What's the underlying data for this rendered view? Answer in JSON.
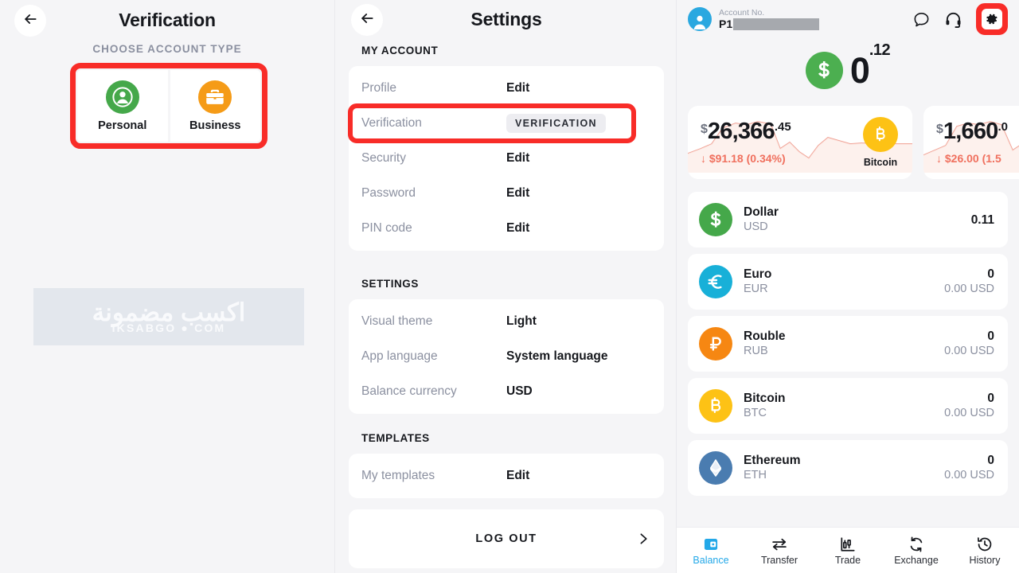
{
  "verification_panel": {
    "back_icon": "arrow-left-icon",
    "title": "Verification",
    "subtitle": "CHOOSE ACCOUNT TYPE",
    "account_types": [
      {
        "label": "Personal",
        "icon": "person-circle-icon",
        "color": "#45a84a"
      },
      {
        "label": "Business",
        "icon": "briefcase-icon",
        "color": "#f59b17"
      }
    ],
    "highlight_color": "#f82c28",
    "watermark": {
      "arabic": "اكسب مضمونة",
      "latin": "IKSABGO ● COM"
    }
  },
  "settings_panel": {
    "back_icon": "arrow-left-icon",
    "title": "Settings",
    "sections": [
      {
        "heading": "MY ACCOUNT",
        "rows": [
          {
            "label": "Profile",
            "value": "Edit",
            "type": "value"
          },
          {
            "label": "Verification",
            "value": "VERIFICATION",
            "type": "badge",
            "highlighted": true
          },
          {
            "label": "Security",
            "value": "Edit",
            "type": "value"
          },
          {
            "label": "Password",
            "value": "Edit",
            "type": "value"
          },
          {
            "label": "PIN code",
            "value": "Edit",
            "type": "value"
          }
        ]
      },
      {
        "heading": "SETTINGS",
        "rows": [
          {
            "label": "Visual theme",
            "value": "Light",
            "type": "value"
          },
          {
            "label": "App language",
            "value": "System language",
            "type": "value"
          },
          {
            "label": "Balance currency",
            "value": "USD",
            "type": "value"
          }
        ]
      },
      {
        "heading": "TEMPLATES",
        "rows": [
          {
            "label": "My templates",
            "value": "Edit",
            "type": "value"
          }
        ]
      }
    ],
    "logout": {
      "label": "LOG OUT",
      "chevron_icon": "chevron-right-icon"
    },
    "highlight_color": "#f82c28"
  },
  "wallet_panel": {
    "header": {
      "avatar_icon": "user-avatar-icon",
      "account_label": "Account No.",
      "account_value": "P1",
      "account_redacted": true,
      "icons": [
        {
          "name": "chat-bubble-icon"
        },
        {
          "name": "headset-icon"
        },
        {
          "name": "gear-icon",
          "highlighted": true
        }
      ]
    },
    "balance": {
      "coin_icon": "dollar-circle-icon",
      "whole": "0",
      "cents": ".12",
      "coin_color": "#4caf50"
    },
    "rate_cards": [
      {
        "currency_symbol": "$",
        "integer": "26,366",
        "decimal": ".45",
        "change": "↓ $91.18 (0.34%)",
        "coin_name": "Bitcoin",
        "coin_icon": "bitcoin-icon",
        "coin_color": "#fdc215",
        "direction": "down"
      },
      {
        "currency_symbol": "$",
        "integer": "1,660",
        "decimal": ".0",
        "change": "↓ $26.00 (1.5",
        "coin_name": "",
        "coin_icon": "ethereum-icon",
        "coin_color": "#4a7cb0",
        "direction": "down"
      }
    ],
    "currencies": [
      {
        "name": "Dollar",
        "code": "USD",
        "amount": "0.11",
        "usd": "",
        "icon": "dollar-icon",
        "color": "#45a84a"
      },
      {
        "name": "Euro",
        "code": "EUR",
        "amount": "0",
        "usd": "0.00 USD",
        "icon": "euro-icon",
        "color": "#18b0d8"
      },
      {
        "name": "Rouble",
        "code": "RUB",
        "amount": "0",
        "usd": "0.00 USD",
        "icon": "rouble-icon",
        "color": "#f68712"
      },
      {
        "name": "Bitcoin",
        "code": "BTC",
        "amount": "0",
        "usd": "0.00 USD",
        "icon": "bitcoin-icon",
        "color": "#fdc215"
      },
      {
        "name": "Ethereum",
        "code": "ETH",
        "amount": "0",
        "usd": "0.00 USD",
        "icon": "ethereum-icon",
        "color": "#4a7cb0"
      }
    ],
    "bottom_nav": {
      "active": "Balance",
      "active_color": "#23a8e8",
      "items": [
        {
          "label": "Balance",
          "icon": "wallet-icon"
        },
        {
          "label": "Transfer",
          "icon": "arrows-exchange-icon"
        },
        {
          "label": "Trade",
          "icon": "candlestick-chart-icon"
        },
        {
          "label": "Exchange",
          "icon": "refresh-cycle-icon"
        },
        {
          "label": "History",
          "icon": "clock-history-icon"
        }
      ]
    }
  }
}
